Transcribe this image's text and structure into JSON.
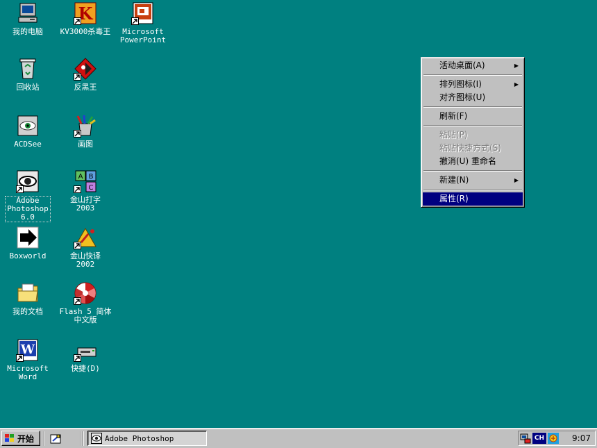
{
  "desktop": {
    "background_color": "#008080",
    "icons": [
      {
        "label": "我的电脑",
        "icon": "my-computer-icon"
      },
      {
        "label": "KV3000杀毒王",
        "icon": "kv3000-antivirus-icon"
      },
      {
        "label": "Microsoft\nPowerPoint",
        "icon": "powerpoint-icon"
      },
      {
        "label": "回收站",
        "icon": "recycle-bin-icon"
      },
      {
        "label": "反黑王",
        "icon": "anti-hacker-icon"
      },
      {
        "label": "ACDSee",
        "icon": "acdsee-icon"
      },
      {
        "label": "画图",
        "icon": "paint-icon"
      },
      {
        "label": "Adobe\nPhotoshop\n6.0",
        "icon": "photoshop-icon"
      },
      {
        "label": "金山打字\n2003",
        "icon": "jinshan-typing-icon"
      },
      {
        "label": "Boxworld",
        "icon": "boxworld-icon"
      },
      {
        "label": "金山快译\n2002",
        "icon": "jinshan-translate-icon"
      },
      {
        "label": "我的文档",
        "icon": "my-documents-icon"
      },
      {
        "label": "Flash 5 简体\n中文版",
        "icon": "flash-icon"
      },
      {
        "label": "Microsoft\nWord",
        "icon": "word-icon"
      },
      {
        "label": "快捷(D)",
        "icon": "drive-shortcut-icon"
      }
    ]
  },
  "context_menu": {
    "items": [
      {
        "label": "活动桌面(A)",
        "submenu": true
      },
      {
        "label": "排列图标(I)",
        "submenu": true
      },
      {
        "label": "对齐图标(U)"
      },
      {
        "label": "刷新(F)"
      },
      {
        "label": "粘贴(P)",
        "disabled": true
      },
      {
        "label": "粘贴快捷方式(S)",
        "disabled": true
      },
      {
        "label": "撤消(U) 重命名"
      },
      {
        "label": "新建(N)",
        "submenu": true
      },
      {
        "label": "属性(R)",
        "highlighted": true
      }
    ],
    "highlight_color": "#000080"
  },
  "taskbar": {
    "start_label": "开始",
    "task_label": "Adobe Photoshop",
    "ime_label": "CH",
    "clock": "9:07"
  }
}
